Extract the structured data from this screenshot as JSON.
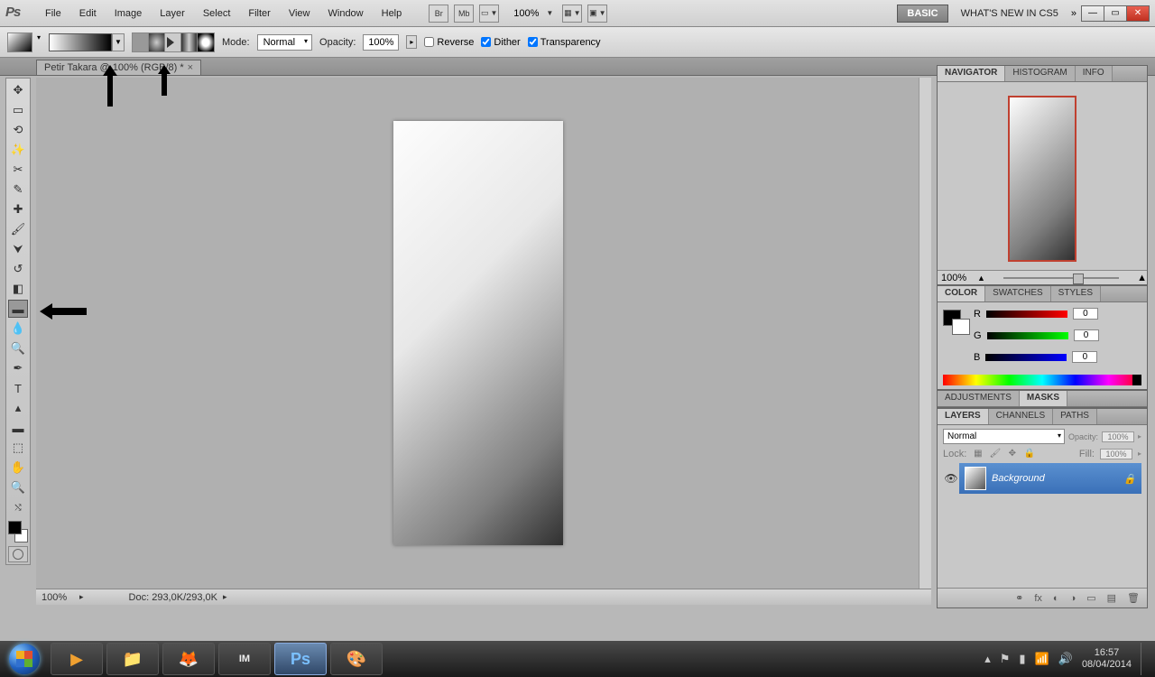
{
  "menubar": {
    "logo": "Ps",
    "items": [
      "File",
      "Edit",
      "Image",
      "Layer",
      "Select",
      "Filter",
      "View",
      "Window",
      "Help"
    ],
    "bridge": "Br",
    "mb": "Mb",
    "zoom": "100%",
    "basic": "BASIC",
    "whatsnew": "WHAT'S NEW IN CS5"
  },
  "optbar": {
    "mode_label": "Mode:",
    "mode_value": "Normal",
    "opacity_label": "Opacity:",
    "opacity_value": "100%",
    "reverse": "Reverse",
    "dither": "Dither",
    "transparency": "Transparency"
  },
  "doc_tab": {
    "title": "Petir Takara @ 100% (RGB/8) *"
  },
  "status": {
    "zoom": "100%",
    "doc": "Doc: 293,0K/293,0K"
  },
  "panels": {
    "navigator": {
      "tabs": [
        "NAVIGATOR",
        "HISTOGRAM",
        "INFO"
      ],
      "zoom": "100%"
    },
    "color": {
      "tabs": [
        "COLOR",
        "SWATCHES",
        "STYLES"
      ],
      "r_lbl": "R",
      "g_lbl": "G",
      "b_lbl": "B",
      "r": "0",
      "g": "0",
      "b": "0"
    },
    "adjust": {
      "tabs": [
        "ADJUSTMENTS",
        "MASKS"
      ]
    },
    "layers": {
      "tabs": [
        "LAYERS",
        "CHANNELS",
        "PATHS"
      ],
      "blend": "Normal",
      "opacity_label": "Opacity:",
      "opacity": "100%",
      "lock_label": "Lock:",
      "fill_label": "Fill:",
      "fill": "100%",
      "layer_name": "Background"
    }
  },
  "taskbar": {
    "time": "16:57",
    "date": "08/04/2014"
  }
}
